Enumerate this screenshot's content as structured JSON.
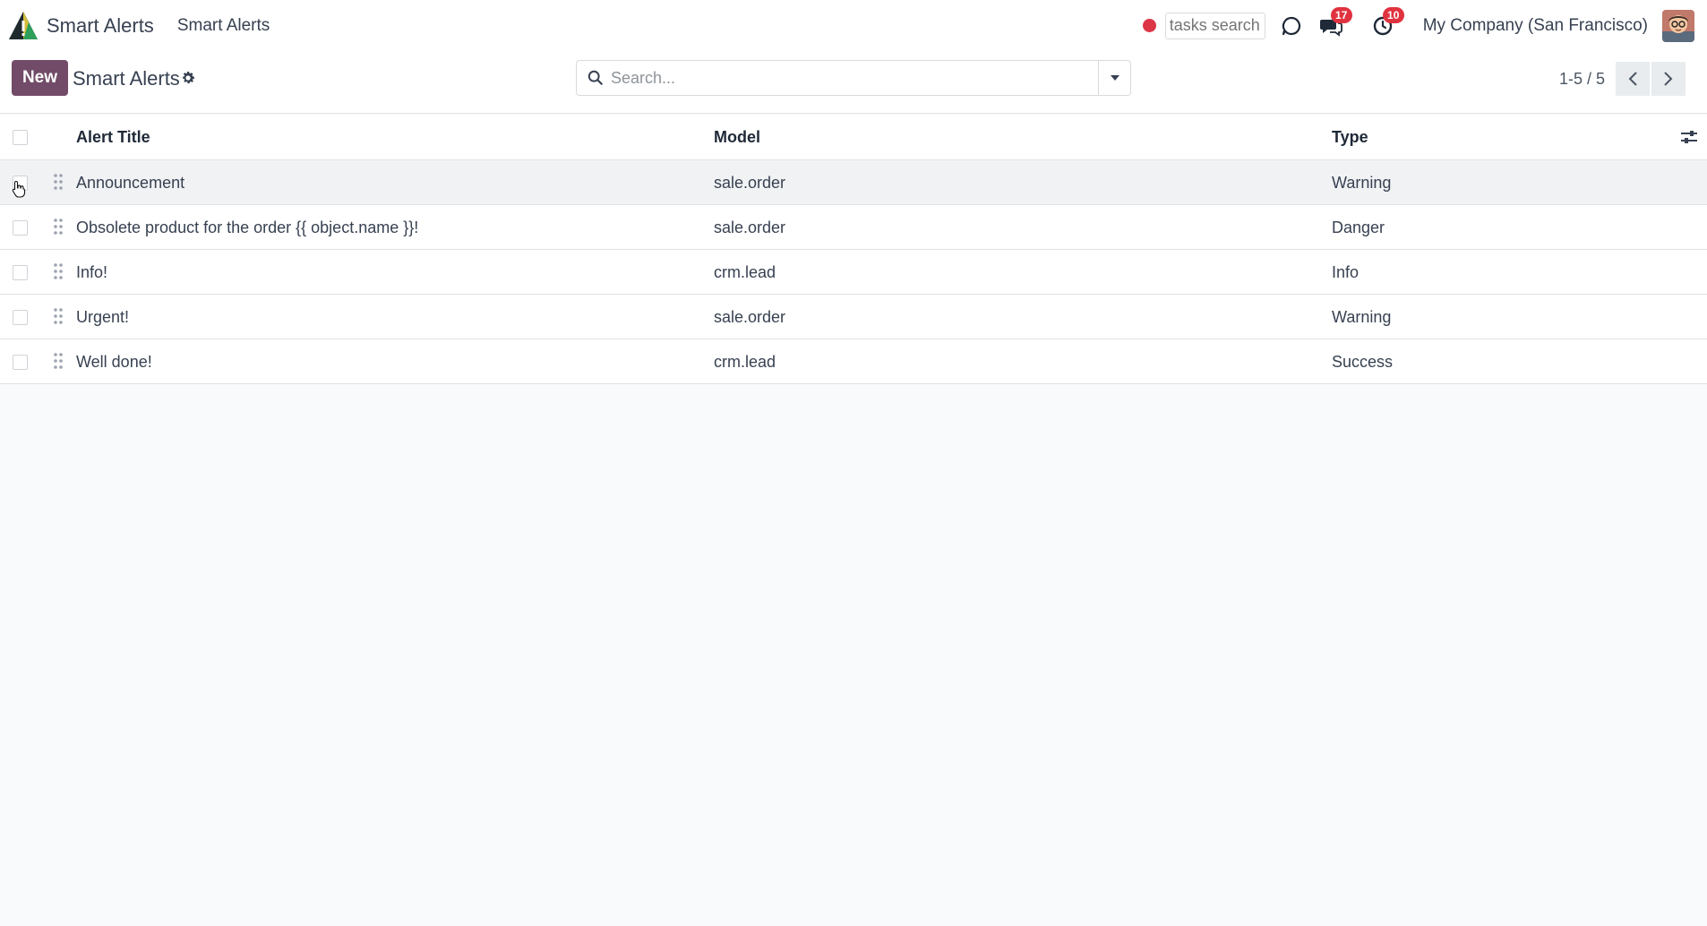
{
  "navbar": {
    "app_name": "Smart Alerts",
    "menu_item": "Smart Alerts",
    "tasks_search_placeholder": "tasks search",
    "messages_badge": "17",
    "activities_badge": "10",
    "company": "My Company (San Francisco)",
    "icons": [
      "app-logo-icon",
      "record-dot-icon",
      "chat-bubble-icon",
      "messages-icon",
      "activity-clock-icon",
      "user-avatar"
    ]
  },
  "control_panel": {
    "new_label": "New",
    "title": "Smart Alerts",
    "search_placeholder": "Search...",
    "pager_value": "1-5 / 5"
  },
  "table": {
    "headers": {
      "title": "Alert Title",
      "model": "Model",
      "type": "Type"
    },
    "rows": [
      {
        "title": "Announcement",
        "model": "sale.order",
        "type": "Warning"
      },
      {
        "title": "Obsolete product for the order {{ object.name }}!",
        "model": "sale.order",
        "type": "Danger"
      },
      {
        "title": "Info!",
        "model": "crm.lead",
        "type": "Info"
      },
      {
        "title": "Urgent!",
        "model": "sale.order",
        "type": "Warning"
      },
      {
        "title": "Well done!",
        "model": "crm.lead",
        "type": "Success"
      }
    ]
  },
  "colors": {
    "brand": "#714b67",
    "badge": "#e0333f",
    "record": "#dc3545",
    "background": "#f9fafb"
  }
}
